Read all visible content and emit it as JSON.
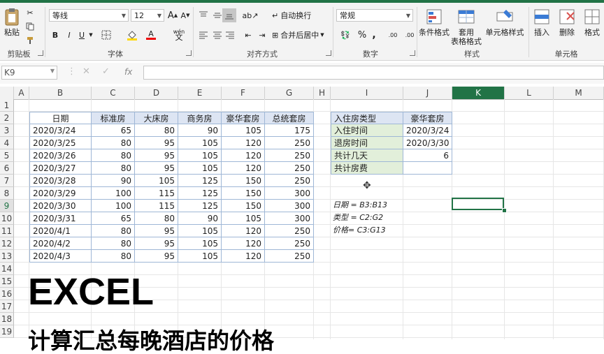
{
  "ribbon": {
    "clipboard": {
      "paste_label": "粘贴",
      "group_label": "剪贴板"
    },
    "font": {
      "name": "等线",
      "size": "12",
      "grow": "A",
      "shrink": "A",
      "bold": "B",
      "italic": "I",
      "underline": "U",
      "font_color_letter": "A",
      "phonetic": "wén",
      "group_label": "字体"
    },
    "alignment": {
      "wrap_text": "自动换行",
      "merge_center": "合并后居中",
      "group_label": "对齐方式"
    },
    "number": {
      "format": "常规",
      "percent": "%",
      "comma": ",",
      "inc_decimal": ".00",
      "dec_decimal": ".00",
      "group_label": "数字"
    },
    "styles": {
      "conditional": "条件格式",
      "table_format_1": "套用",
      "table_format_2": "表格格式",
      "cell_styles": "单元格样式",
      "group_label": "样式"
    },
    "cells": {
      "insert": "插入",
      "delete": "删除",
      "format": "格式",
      "group_label": "单元格"
    }
  },
  "formula_bar": {
    "name_box": "K9",
    "fx": "fx",
    "content": ""
  },
  "columns": [
    "A",
    "B",
    "C",
    "D",
    "E",
    "F",
    "G",
    "H",
    "I",
    "J",
    "K",
    "L",
    "M"
  ],
  "rows": [
    "1",
    "2",
    "3",
    "4",
    "5",
    "6",
    "7",
    "8",
    "9",
    "10",
    "11",
    "12",
    "13",
    "14",
    "15",
    "16",
    "17",
    "18",
    "19"
  ],
  "active": {
    "column": "K",
    "row": "9"
  },
  "main_table": {
    "headers": [
      "日期",
      "标准房",
      "大床房",
      "商务房",
      "豪华套房",
      "总统套房"
    ],
    "rows": [
      [
        "2020/3/24",
        "65",
        "80",
        "90",
        "105",
        "175"
      ],
      [
        "2020/3/25",
        "80",
        "95",
        "105",
        "120",
        "250"
      ],
      [
        "2020/3/26",
        "80",
        "95",
        "105",
        "120",
        "250"
      ],
      [
        "2020/3/27",
        "80",
        "95",
        "105",
        "120",
        "250"
      ],
      [
        "2020/3/28",
        "90",
        "105",
        "125",
        "150",
        "250"
      ],
      [
        "2020/3/29",
        "100",
        "115",
        "125",
        "150",
        "300"
      ],
      [
        "2020/3/30",
        "100",
        "115",
        "125",
        "150",
        "300"
      ],
      [
        "2020/3/31",
        "65",
        "80",
        "90",
        "105",
        "300"
      ],
      [
        "2020/4/1",
        "80",
        "95",
        "105",
        "120",
        "250"
      ],
      [
        "2020/4/2",
        "80",
        "95",
        "105",
        "120",
        "250"
      ],
      [
        "2020/4/3",
        "80",
        "95",
        "105",
        "120",
        "250"
      ]
    ]
  },
  "side_table": {
    "rows": [
      [
        "入住房类型",
        "豪华套房"
      ],
      [
        "入住时间",
        "2020/3/24"
      ],
      [
        "退房时间",
        "2020/3/30"
      ],
      [
        "共计几天",
        "6"
      ],
      [
        "共计房费",
        ""
      ]
    ]
  },
  "notes": [
    "日期 = B3:B13",
    "类型 = C2:G2",
    "价格= C3:G13"
  ],
  "overlay": {
    "title": "EXCEL",
    "subtitle": "计算汇总每晚酒店的价格"
  },
  "colors": {
    "excel_green": "#217346",
    "header_blue": "#dde5f3",
    "label_green": "#e2efda"
  }
}
